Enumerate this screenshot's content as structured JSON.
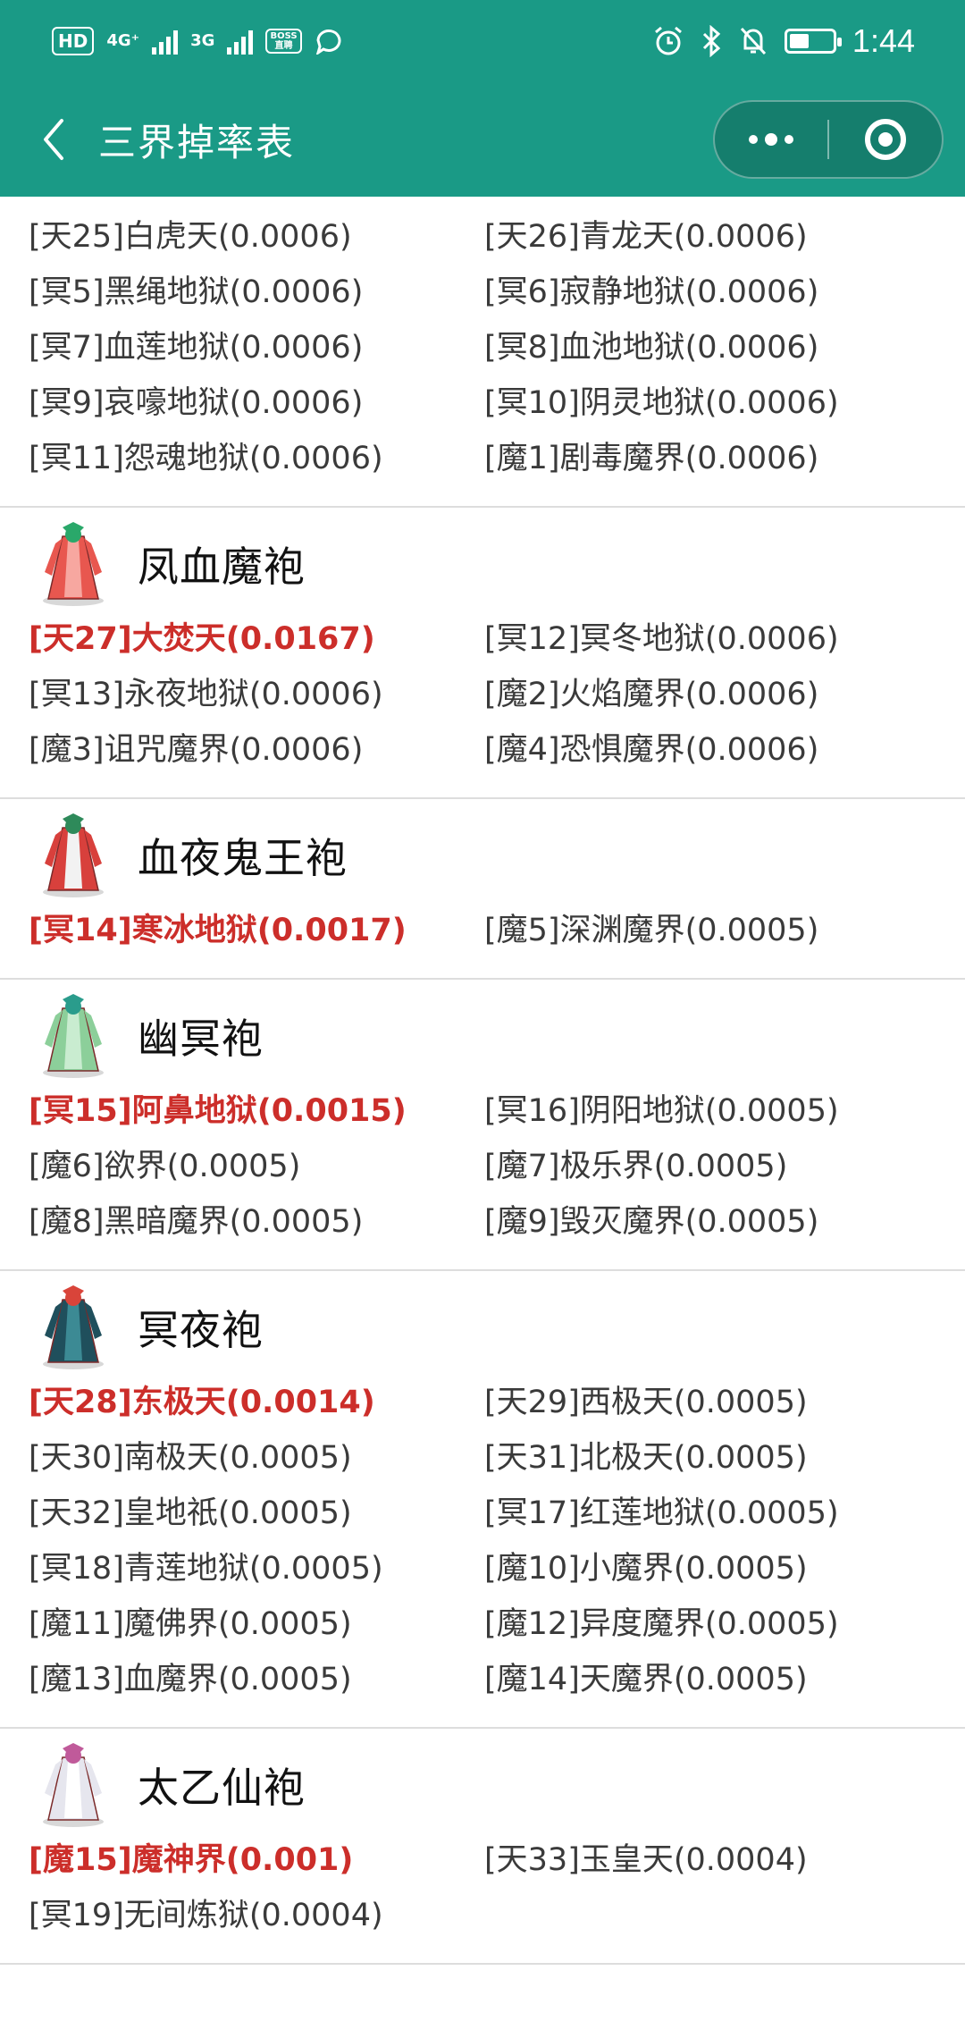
{
  "status_bar": {
    "hd": "HD",
    "sim1_net": "4G⁺",
    "sim2_net": "3G",
    "boss_badge": "BOSS\n直聘",
    "time": "1:44",
    "battery_level": 0.45
  },
  "nav": {
    "title": "三界掉率表"
  },
  "colors": {
    "header_bg": "#1a9a86",
    "highlight": "#cc2e2a",
    "text": "#3a3a3a"
  },
  "top_partial": {
    "items": [
      {
        "text": "[天25]白虎天(0.0006)",
        "hi": false
      },
      {
        "text": "[天26]青龙天(0.0006)",
        "hi": false
      },
      {
        "text": "[冥5]黑绳地狱(0.0006)",
        "hi": false
      },
      {
        "text": "[冥6]寂静地狱(0.0006)",
        "hi": false
      },
      {
        "text": "[冥7]血莲地狱(0.0006)",
        "hi": false
      },
      {
        "text": "[冥8]血池地狱(0.0006)",
        "hi": false
      },
      {
        "text": "[冥9]哀嚎地狱(0.0006)",
        "hi": false
      },
      {
        "text": "[冥10]阴灵地狱(0.0006)",
        "hi": false
      },
      {
        "text": "[冥11]怨魂地狱(0.0006)",
        "hi": false
      },
      {
        "text": "[魔1]剧毒魔界(0.0006)",
        "hi": false
      }
    ]
  },
  "sections": [
    {
      "name": "凤血魔袍",
      "icon": "red-robe-icon",
      "items": [
        {
          "text": "[天27]大焚天(0.0167)",
          "hi": true
        },
        {
          "text": "[冥12]冥冬地狱(0.0006)",
          "hi": false
        },
        {
          "text": "[冥13]永夜地狱(0.0006)",
          "hi": false
        },
        {
          "text": "[魔2]火焰魔界(0.0006)",
          "hi": false
        },
        {
          "text": "[魔3]诅咒魔界(0.0006)",
          "hi": false
        },
        {
          "text": "[魔4]恐惧魔界(0.0006)",
          "hi": false
        }
      ]
    },
    {
      "name": "血夜鬼王袍",
      "icon": "ghost-king-robe-icon",
      "items": [
        {
          "text": "[冥14]寒冰地狱(0.0017)",
          "hi": true
        },
        {
          "text": "[魔5]深渊魔界(0.0005)",
          "hi": false
        }
      ]
    },
    {
      "name": "幽冥袍",
      "icon": "green-robe-icon",
      "items": [
        {
          "text": "[冥15]阿鼻地狱(0.0015)",
          "hi": true
        },
        {
          "text": "[冥16]阴阳地狱(0.0005)",
          "hi": false
        },
        {
          "text": "[魔6]欲界(0.0005)",
          "hi": false
        },
        {
          "text": "[魔7]极乐界(0.0005)",
          "hi": false
        },
        {
          "text": "[魔8]黑暗魔界(0.0005)",
          "hi": false
        },
        {
          "text": "[魔9]毁灭魔界(0.0005)",
          "hi": false
        }
      ]
    },
    {
      "name": "冥夜袍",
      "icon": "dark-robe-icon",
      "items": [
        {
          "text": "[天28]东极天(0.0014)",
          "hi": true
        },
        {
          "text": "[天29]西极天(0.0005)",
          "hi": false
        },
        {
          "text": "[天30]南极天(0.0005)",
          "hi": false
        },
        {
          "text": "[天31]北极天(0.0005)",
          "hi": false
        },
        {
          "text": "[天32]皇地祇(0.0005)",
          "hi": false
        },
        {
          "text": "[冥17]红莲地狱(0.0005)",
          "hi": false
        },
        {
          "text": "[冥18]青莲地狱(0.0005)",
          "hi": false
        },
        {
          "text": "[魔10]小魔界(0.0005)",
          "hi": false
        },
        {
          "text": "[魔11]魔佛界(0.0005)",
          "hi": false
        },
        {
          "text": "[魔12]异度魔界(0.0005)",
          "hi": false
        },
        {
          "text": "[魔13]血魔界(0.0005)",
          "hi": false
        },
        {
          "text": "[魔14]天魔界(0.0005)",
          "hi": false
        }
      ]
    },
    {
      "name": "太乙仙袍",
      "icon": "white-robe-icon",
      "items": [
        {
          "text": "[魔15]魔神界(0.001)",
          "hi": true
        },
        {
          "text": "[天33]玉皇天(0.0004)",
          "hi": false
        },
        {
          "text": "[冥19]无间炼狱(0.0004)",
          "hi": false
        }
      ]
    }
  ]
}
